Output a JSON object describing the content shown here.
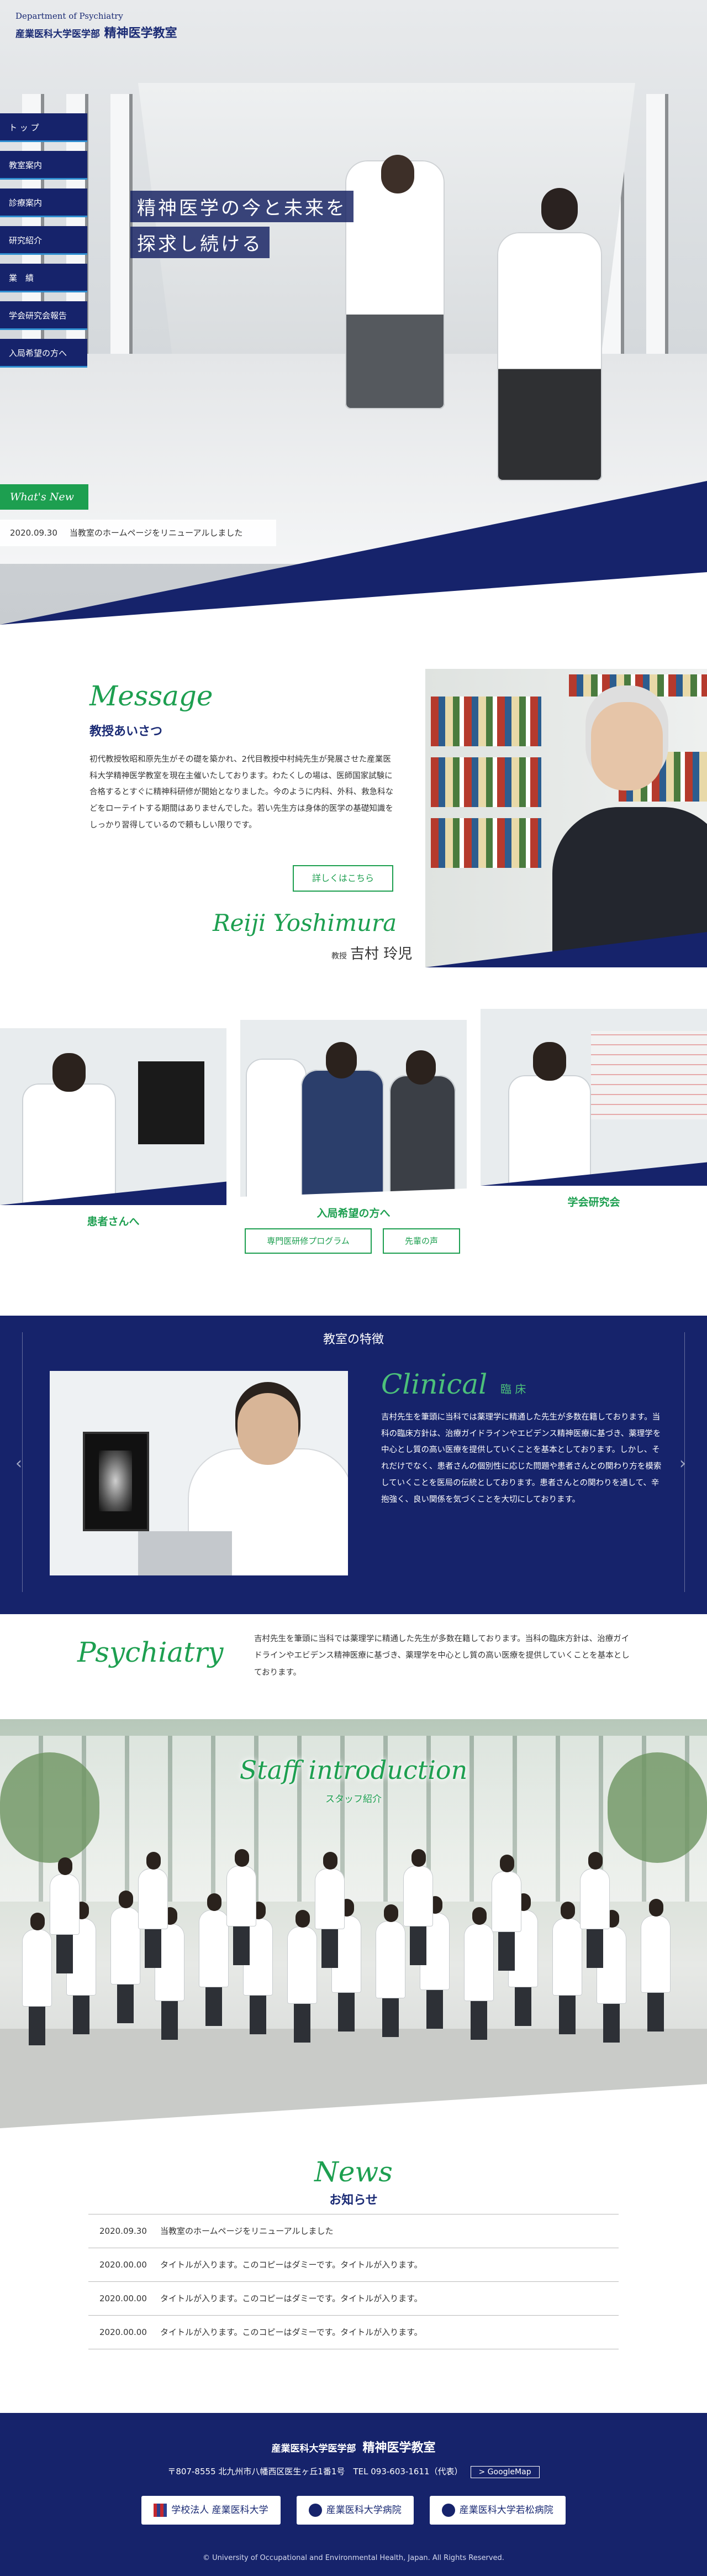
{
  "header": {
    "brand_en": "Department of Psychiatry",
    "brand_jp_univ": "産業医科大学医学部",
    "brand_jp_dept": "精神医学教室"
  },
  "nav": {
    "items": [
      "ト ッ プ",
      "教室案内",
      "診療案内",
      "研究紹介",
      "業　績",
      "学会研究会報告",
      "入局希望の方へ"
    ]
  },
  "hero": {
    "catch_line1": "精神医学の今と未来を",
    "catch_line2": "探求し続ける"
  },
  "whats_new": {
    "tag": "What's New",
    "date": "2020.09.30",
    "text": "当教室のホームページをリニューアルしました"
  },
  "message": {
    "title_en": "Message",
    "title_jp": "教授あいさつ",
    "body": "初代教授牧昭和原先生がその礎を築かれ、2代目教授中村純先生が発展させた産業医科大学精神医学教室を現在主催いたしております。わたくしの場は、医師国家試験に合格するとすぐに精神科研修が開始となりました。今のように内科、外科、救急科などをローテイトする期間はありませんでした。若い先生方は身体的医学の基礎知識をしっかり習得しているので頼もしい限りです。",
    "more_button": "詳しくはこちら",
    "name_en": "Reiji Yoshimura",
    "name_title": "教授",
    "name_jp": "吉村 玲児"
  },
  "cards": {
    "patients_label": "患者さんへ",
    "applicants_label": "入局希望の方へ",
    "program_button": "専門医研修プログラム",
    "senior_button": "先輩の声",
    "society_label": "学会研究会"
  },
  "feature": {
    "title": "教室の特徴",
    "title_en": "Clinical",
    "title_jp": "臨 床",
    "body": "吉村先生を筆頭に当科では薬理学に精通した先生が多数在籍しております。当科の臨床方針は、治療ガイドラインやエビデンス精神医療に基づき、薬理学を中心とし質の高い医療を提供していくことを基本としております。しかし、それだけでなく、患者さんの個別性に応じた問題や患者さんとの関わり方を模索していくことを医局の伝統としております。患者さんとの関わりを通して、辛抱強く、良い関係を気づくことを大切にしております。"
  },
  "psychiatry": {
    "title_en": "Psychiatry",
    "body": "吉村先生を筆頭に当科では薬理学に精通した先生が多数在籍しております。当科の臨床方針は、治療ガイドラインやエビデンス精神医療に基づき、薬理学を中心とし質の高い医療を提供していくことを基本としております。"
  },
  "staff": {
    "title_en": "Staff introduction",
    "title_jp": "スタッフ紹介"
  },
  "news": {
    "title_en": "News",
    "title_jp": "お知らせ",
    "items": [
      {
        "date": "2020.09.30",
        "text": "当教室のホームページをリニューアルしました"
      },
      {
        "date": "2020.00.00",
        "text": "タイトルが入ります。このコピーはダミーです。タイトルが入ります。"
      },
      {
        "date": "2020.00.00",
        "text": "タイトルが入ります。このコピーはダミーです。タイトルが入ります。"
      },
      {
        "date": "2020.00.00",
        "text": "タイトルが入ります。このコピーはダミーです。タイトルが入ります。"
      }
    ]
  },
  "footer": {
    "univ": "産業医科大学医学部",
    "dept": "精神医学教室",
    "address": "〒807-8555 北九州市八幡西区医生ヶ丘1番1号　TEL 093-603-1611（代表）",
    "map_button": "> GoogleMap",
    "links": [
      "学校法人 産業医科大学",
      "産業医科大学病院",
      "産業医科大学若松病院"
    ],
    "copyright": "© University of Occupational and Environmental Health, Japan. All Rights Reserved."
  },
  "colors": {
    "navy": "#16236b",
    "green": "#1d9f50",
    "accent_blue": "#2f8fd1"
  }
}
